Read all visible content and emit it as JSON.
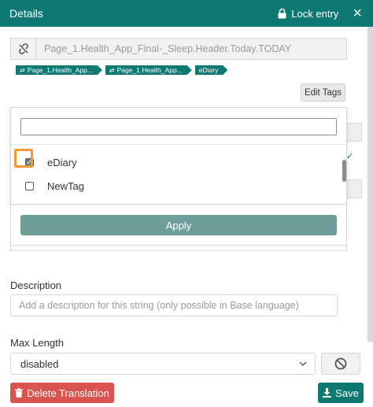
{
  "header": {
    "title": "Details",
    "lock_label": "Lock entry",
    "close_glyph": "×"
  },
  "key": {
    "value": "Page_1.Health_App_Final-_Sleep.Header.Today.TODAY"
  },
  "tags": [
    {
      "label": "Page_1.Health_App...",
      "icon": "sync-icon"
    },
    {
      "label": "Page_1.Health_App...",
      "icon": "sync-icon"
    },
    {
      "label": "eDiary"
    }
  ],
  "edit_tags": {
    "label": "Edit Tags"
  },
  "tag_dropdown": {
    "search_value": "",
    "items": [
      {
        "label": "eDiary",
        "checked": true
      },
      {
        "label": "NewTag",
        "checked": false
      }
    ],
    "apply_label": "Apply"
  },
  "description": {
    "label": "Description",
    "placeholder": "Add a description for this string (only possible in Base language)"
  },
  "max_length": {
    "label": "Max Length",
    "value": "disabled"
  },
  "footer": {
    "delete_label": "Delete Translation",
    "save_label": "Save"
  },
  "colors": {
    "accent": "#0e7872",
    "danger": "#d9534f",
    "focus": "#f29a3a",
    "apply": "#6f9e9a"
  }
}
